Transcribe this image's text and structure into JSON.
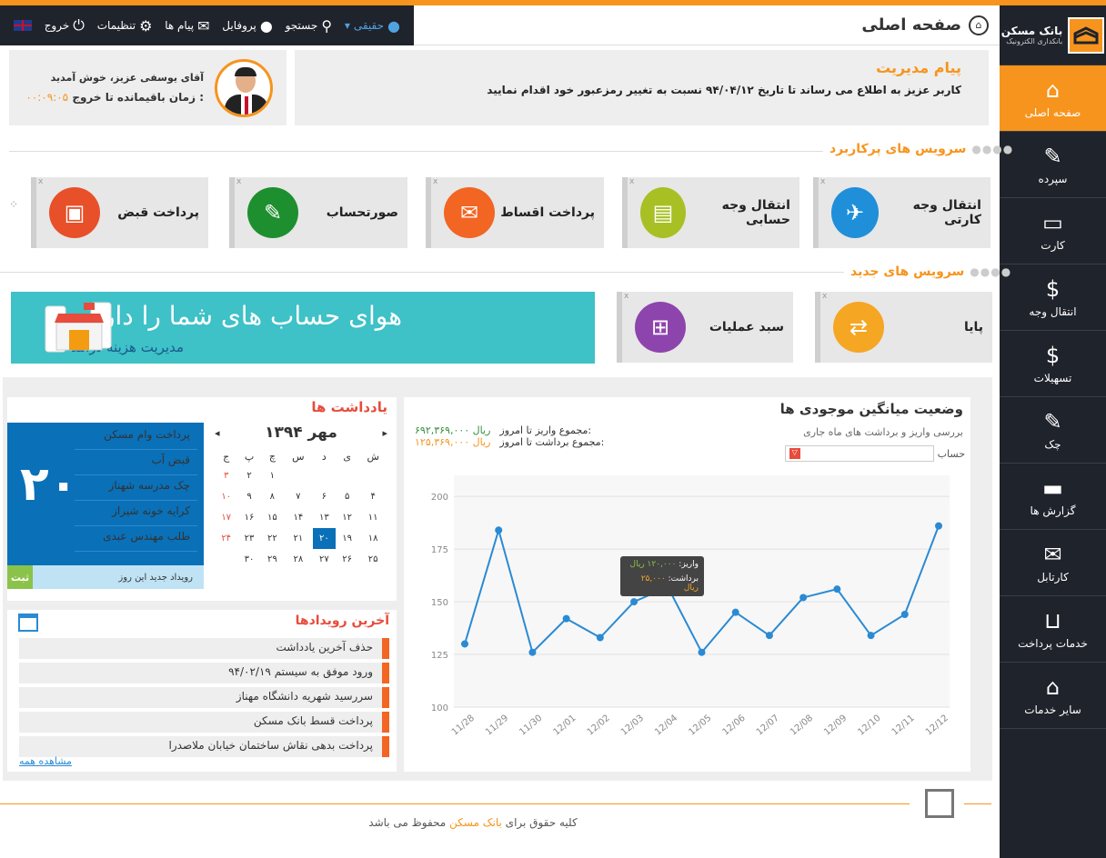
{
  "brand": {
    "name": "بانک مسکن",
    "sub": "بانکداری الکترونیک"
  },
  "sidebar": {
    "items": [
      {
        "label": "صفحه اصلی",
        "icon": "home-icon",
        "glyph": "⌂"
      },
      {
        "label": "سپرده",
        "icon": "pen-icon",
        "glyph": "✎"
      },
      {
        "label": "کارت",
        "icon": "card-icon",
        "glyph": "▭"
      },
      {
        "label": "انتقال وجه",
        "icon": "money-transfer-icon",
        "glyph": "$"
      },
      {
        "label": "تسهیلات",
        "icon": "loan-icon",
        "glyph": "$"
      },
      {
        "label": "چک",
        "icon": "cheque-icon",
        "glyph": "✎"
      },
      {
        "label": "گزارش ها",
        "icon": "report-icon",
        "glyph": "▬"
      },
      {
        "label": "کارتابل",
        "icon": "inbox-icon",
        "glyph": "✉"
      },
      {
        "label": "خدمات پرداخت",
        "icon": "payment-icon",
        "glyph": "⊔"
      },
      {
        "label": "سایر خدمات",
        "icon": "hand-house-icon",
        "glyph": "⌂"
      }
    ]
  },
  "topbar": {
    "user": "حقیقی",
    "search": "جستجو",
    "profile": "پروفایل",
    "messages": "پیام ها",
    "settings": "تنظیمات",
    "exit": "خروج"
  },
  "page": {
    "title": "صفحه اصلی"
  },
  "message": {
    "title": "پیام مدیریت",
    "body": "کاربر عزیز به اطلاع می رساند تا تاریخ ۹۴/۰۴/۱۲ نسبت به تغییر رمزعبور خود اقدام نمایید"
  },
  "profile": {
    "greeting": "آقای یوسفی عزیز، خوش آمدید",
    "timer_label": "زمان باقیمانده تا خروج :",
    "timer": "۰۰:۰۹:۰۵"
  },
  "sections": {
    "popular": "سرویس های پرکاربرد",
    "new": "سرویس های جدید"
  },
  "popular": [
    {
      "label": "انتقال وجه کارتی",
      "color": "#1f8fd9"
    },
    {
      "label": "انتقال وجه حسابی",
      "color": "#a8c024"
    },
    {
      "label": "پرداخت اقساط",
      "color": "#f26522"
    },
    {
      "label": "صورتحساب",
      "color": "#1e8f2e"
    },
    {
      "label": "پرداخت قبض",
      "color": "#e8502a"
    }
  ],
  "new_services": [
    {
      "label": "پایا",
      "color": "#f5a623"
    },
    {
      "label": "سبد عملیات",
      "color": "#8e44ad"
    }
  ],
  "banner": {
    "title": "هوای حساب های شما را داریم",
    "subtitle": "مدیریت هزینه درآمد"
  },
  "notes": {
    "title": "یادداشت ها",
    "day": "۲۰",
    "items": [
      "پرداخت وام مسکن",
      "قبض آب",
      "چک مدرسه شهناز",
      "کرایه خونه شیراز",
      "طلب مهندس عبدی"
    ],
    "add_label": "رویداد جدید این روز",
    "submit": "ثبت"
  },
  "calendar": {
    "month": "مهر ۱۳۹۴",
    "days": [
      "ش",
      "ی",
      "د",
      "س",
      "چ",
      "پ",
      "ج"
    ],
    "weeks": [
      [
        "",
        "",
        "",
        "",
        "۱",
        "۲",
        "۳"
      ],
      [
        "۴",
        "۵",
        "۶",
        "۷",
        "۸",
        "۹",
        "۱۰"
      ],
      [
        "۱۱",
        "۱۲",
        "۱۳",
        "۱۴",
        "۱۵",
        "۱۶",
        "۱۷"
      ],
      [
        "۱۸",
        "۱۹",
        "۲۰",
        "۲۱",
        "۲۲",
        "۲۳",
        "۲۴"
      ],
      [
        "۲۵",
        "۲۶",
        "۲۷",
        "۲۸",
        "۲۹",
        "۳۰",
        ""
      ]
    ],
    "today": "۲۰"
  },
  "events": {
    "title": "آخرین رویدادها",
    "items": [
      "حذف آخرین یادداشت",
      "ورود موفق به سیستم ۹۴/۰۲/۱۹",
      "سررسید شهریه دانشگاه مهناز",
      "پرداخت قسط بانک مسکن",
      "پرداخت بدهی نقاش ساختمان خیابان ملاصدرا"
    ],
    "view_all": "مشاهده همه"
  },
  "chart": {
    "title": "وضعیت میانگین موجودی ها",
    "subtitle": "بررسی واریز و برداشت های ماه جاری",
    "account_label": "حساب",
    "dropdown_icon": "▽",
    "deposit_label": "مجموع واریز تا امروز:",
    "deposit_value": "۶۹۲,۳۶۹,۰۰۰ ریال",
    "withdraw_label": "مجموع برداشت تا امروز:",
    "withdraw_value": "۱۲۵,۳۶۹,۰۰۰ ریال",
    "tooltip": {
      "dep_label": "واریز:",
      "dep_value": "۱۲۰,۰۰۰ ریال",
      "wd_label": "برداشت:",
      "wd_value": "۲۵,۰۰۰ ریال"
    }
  },
  "chart_data": {
    "type": "line",
    "x": [
      "11/28",
      "11/29",
      "11/30",
      "12/01",
      "12/02",
      "12/03",
      "12/04",
      "12/05",
      "12/06",
      "12/07",
      "12/08",
      "12/09",
      "12/10",
      "12/11",
      "12/12"
    ],
    "values": [
      130,
      184,
      126,
      142,
      133,
      150,
      157,
      126,
      145,
      134,
      152,
      156,
      134,
      144,
      186
    ],
    "ylim": [
      100,
      210
    ],
    "yticks": [
      100,
      125,
      150,
      175,
      200
    ],
    "grid": true,
    "color": "#2a8ad3"
  },
  "footer": {
    "prefix": "کلیه حقوق برای",
    "bank": "بانک مسکن",
    "suffix": "محفوظ می باشد"
  }
}
